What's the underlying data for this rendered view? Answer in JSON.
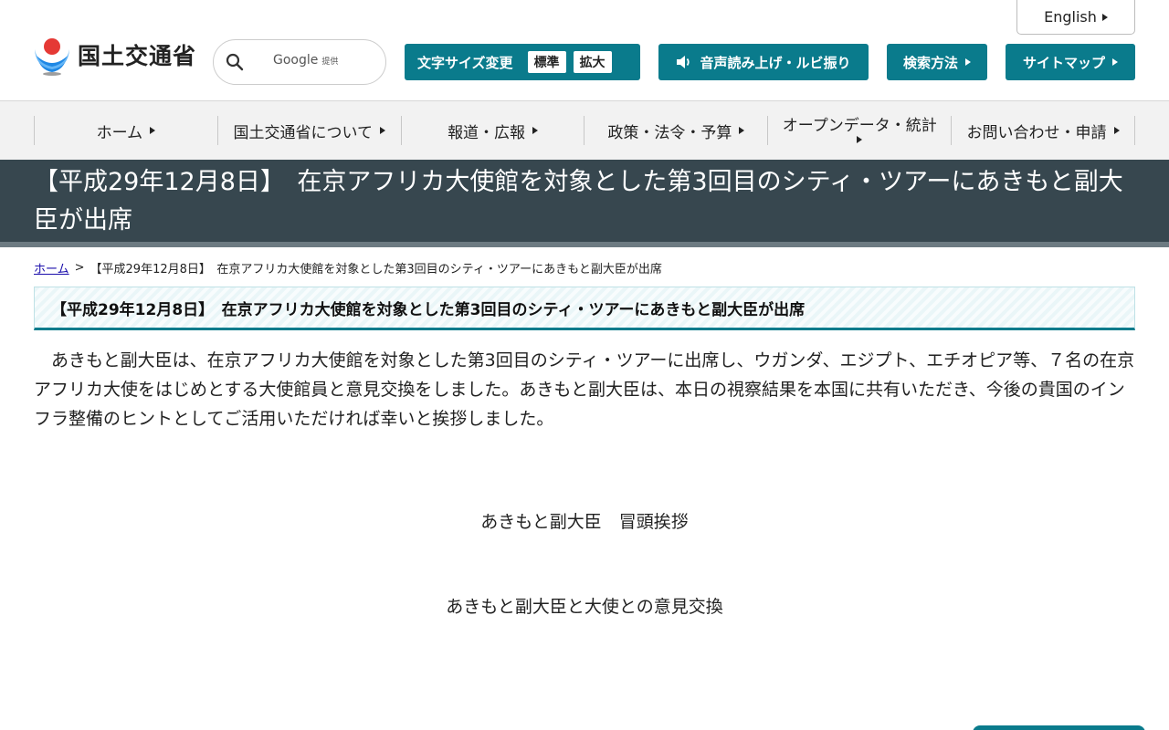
{
  "header": {
    "english_label": "English",
    "logo_text": "国土交通省",
    "search": {
      "label": "Google",
      "label_suffix": "提供",
      "placeholder": ""
    },
    "font_size": {
      "label": "文字サイズ変更",
      "standard": "標準",
      "large": "拡大"
    },
    "voice_label": "音声読み上げ・ルビ振り",
    "search_method_label": "検索方法",
    "sitemap_label": "サイトマップ"
  },
  "nav": {
    "items": [
      {
        "label": "ホーム"
      },
      {
        "label": "国土交通省について"
      },
      {
        "label": "報道・広報"
      },
      {
        "label": "政策・法令・予算"
      },
      {
        "label": "オープンデータ・統計"
      },
      {
        "label": "お問い合わせ・申請"
      }
    ]
  },
  "page": {
    "title": "【平成29年12月8日】　在京アフリカ大使館を対象とした第3回目のシティ・ツアーにあきもと副大臣が出席",
    "breadcrumb": {
      "home": "ホーム",
      "separator": ">",
      "current": "【平成29年12月8日】　在京アフリカ大使館を対象とした第3回目のシティ・ツアーにあきもと副大臣が出席"
    },
    "section_heading": "【平成29年12月8日】　在京アフリカ大使館を対象とした第3回目のシティ・ツアーにあきもと副大臣が出席",
    "body": "あきもと副大臣は、在京アフリカ大使館を対象とした第3回目のシティ・ツアーに出席し、ウガンダ、エジプト、エチオピア等、７名の在京アフリカ大使をはじめとする大使館員と意見交換をしました。あきもと副大臣は、本日の視察結果を本国に共有いただき、今後の貴国のインフラ整備のヒントとしてご活用いただければ幸いと挨拶しました。",
    "captions": [
      "あきもと副大臣　冒頭挨拶",
      "あきもと副大臣と大使との意見交換"
    ]
  },
  "colors": {
    "accent": "#0a7b8c",
    "title_band": "#37474f",
    "nav_bg": "#f2f2f2"
  }
}
